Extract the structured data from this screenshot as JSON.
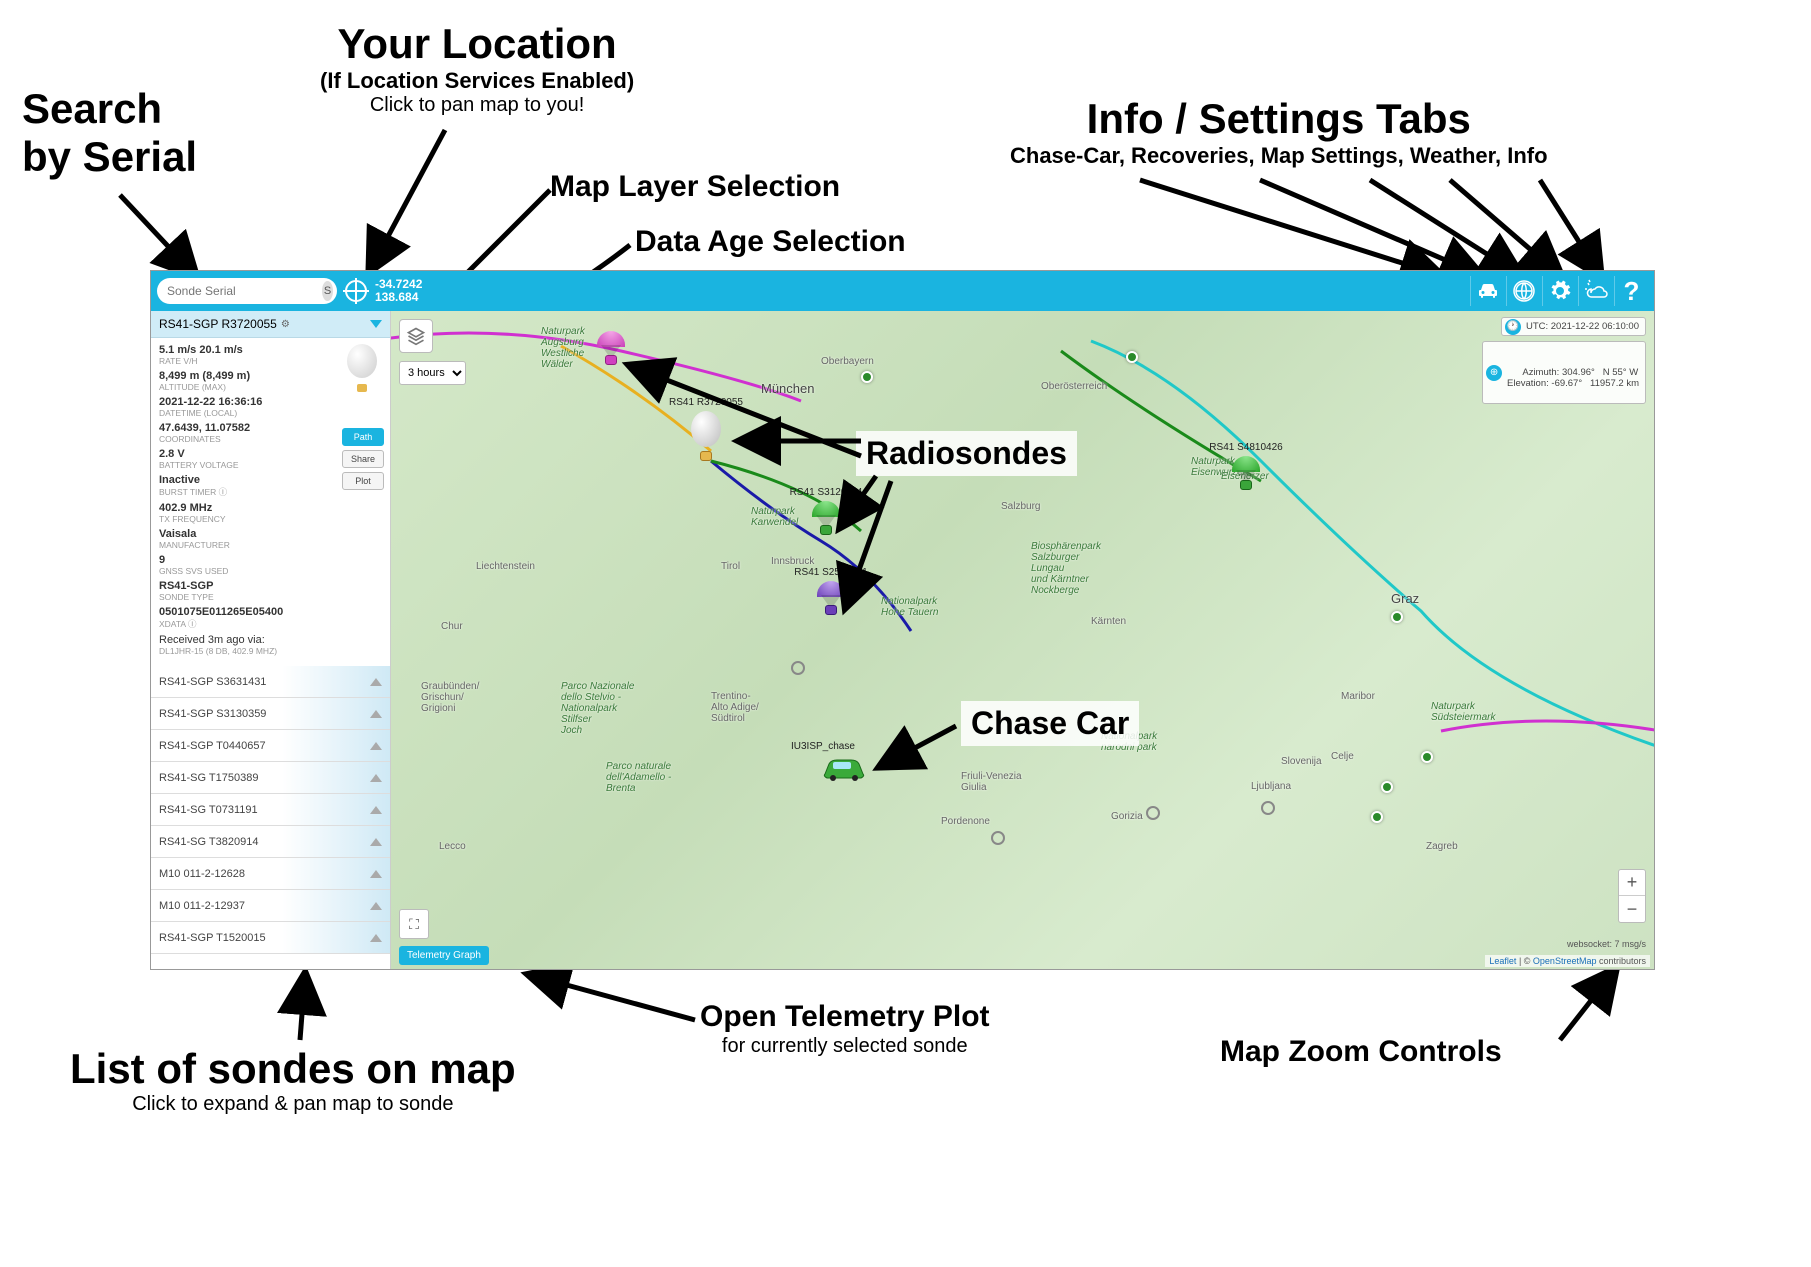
{
  "annotations": {
    "search": {
      "title": "Search",
      "line2": "by Serial"
    },
    "location": {
      "title": "Your Location",
      "sub1": "(If Location Services Enabled)",
      "sub2": "Click to pan map to you!"
    },
    "layer": "Map Layer Selection",
    "age": "Data Age Selection",
    "tabs": {
      "title": "Info / Settings Tabs",
      "sub": "Chase-Car, Recoveries, Map Settings, Weather, Info"
    },
    "radiosondes": "Radiosondes",
    "chasecar": "Chase Car",
    "telemetry": {
      "title": "Open Telemetry Plot",
      "sub": "for currently selected sonde"
    },
    "list": {
      "title": "List of sondes on map",
      "sub": "Click to expand & pan map to sonde"
    },
    "zoom": "Map Zoom Controls"
  },
  "topbar": {
    "search_placeholder": "Sonde Serial",
    "search_btn": "S",
    "lat": "-34.7242",
    "lon": "138.684",
    "help": "?"
  },
  "status": {
    "utc_label": "UTC: 2021-12-22 06:10:00",
    "az_el": "Azimuth: 304.96°   N 55° W\nElevation: -69.67°   11957.2 km"
  },
  "age_select": "3 hours",
  "telemetry_btn": "Telemetry Graph",
  "ws_status": "websocket: 7 msg/s",
  "attribution": {
    "leaflet": "Leaflet",
    "sep": " | © ",
    "osm": "OpenStreetMap",
    "tail": " contributors"
  },
  "selected_sonde": {
    "header": "RS41-SGP R3720055",
    "rate": "5.1 m/s 20.1 m/s",
    "rate_lbl": "RATE V/H",
    "alt": "8,499 m (8,499 m)",
    "alt_lbl": "ALTITUDE (MAX)",
    "dt": "2021-12-22 16:36:16",
    "dt_lbl": "DATETIME (LOCAL)",
    "coord": "47.6439, 11.07582",
    "coord_lbl": "COORDINATES",
    "batt": "2.8 V",
    "batt_lbl": "BATTERY VOLTAGE",
    "burst": "Inactive",
    "burst_lbl": "BURST TIMER ⓘ",
    "freq": "402.9 MHz",
    "freq_lbl": "TX FREQUENCY",
    "mfr": "Vaisala",
    "mfr_lbl": "MANUFACTURER",
    "svs": "9",
    "svs_lbl": "GNSS SVS USED",
    "type": "RS41-SGP",
    "type_lbl": "SONDE TYPE",
    "xdata": "0501075E011265E05400",
    "xdata_lbl": "XDATA ⓘ",
    "rx": "Received 3m ago via:",
    "rx2": "DL1JHR-15 (8 DB, 402.9 MHZ)",
    "btn_path": "Path",
    "btn_share": "Share",
    "btn_plot": "Plot"
  },
  "sonde_list": [
    "RS41-SGP S3631431",
    "RS41-SGP S3130359",
    "RS41-SGP T0440657",
    "RS41-SG T1750389",
    "RS41-SG T0731191",
    "RS41-SG T3820914",
    "M10 011-2-12628",
    "M10 011-2-12937",
    "RS41-SGP T1520015"
  ],
  "map_labels": {
    "munchen": "München",
    "oberbayern": "Oberbayern",
    "salzburg": "Salzburg",
    "graz": "Graz",
    "ljubljana": "Ljubljana",
    "slovenija": "Slovenija",
    "maribor": "Maribor",
    "liechtenstein": "Liechtenstein",
    "tirol": "Tirol",
    "innsbruck": "Innsbruck",
    "chur": "Chur",
    "lecco": "Lecco",
    "pordenone": "Pordenone",
    "gorizia": "Gorizia",
    "celje": "Celje",
    "karnten": "Kärnten",
    "oberosterreich": "Oberösterreich",
    "eisenerz": "Eisenerzer",
    "trentino": "Trentino-\nAlto Adige/\nSüdtirol",
    "park1": "Naturpark\nAugsburg\nWestliche\nWälder",
    "park2": "Naturpark\nKarwendel",
    "park3": "Parco Nazionale\ndello Stelvio -\nNationalpark\nStilfser\nJoch",
    "park4": "Parco naturale\ndell'Adamello -\nBrenta",
    "park5": "Biosphärenpark\nSalzburger\nLungau\nund Kärntner\nNockberge",
    "park6": "Nationalpark\nHohe Tauern",
    "park7": "Nationalpark\nnarodni park",
    "park8": "Naturpark\nEisenwurzen",
    "park9": "Naturpark\nSüdsteiermark",
    "friuli": "Friuli-Venezia\nGiulia",
    "graubunden": "Graubünden/\nGrischun/\nGrigioni",
    "zagreb": "Zagreb"
  },
  "sonde_markers": {
    "r3720055": "RS41 R3720055",
    "s3120114": "RS41 S3120114",
    "s2530601": "RS41 S2530601",
    "s4810426": "RS41 S4810426"
  },
  "chase_label": "IU3ISP_chase"
}
